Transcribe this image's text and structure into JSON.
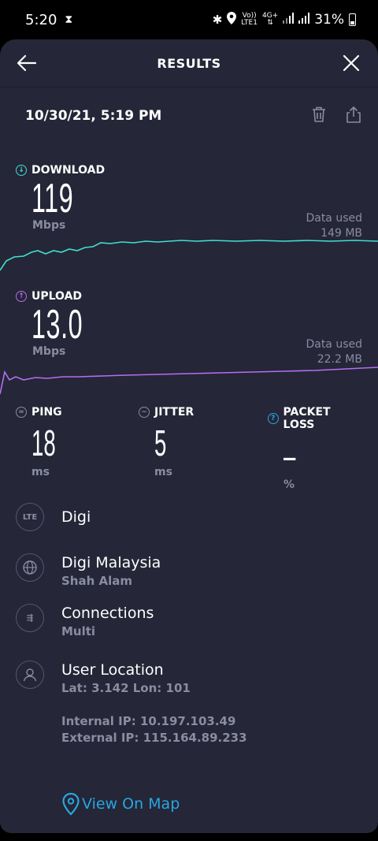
{
  "status_bar": {
    "time": "5:20",
    "carrier_top": "Vo))",
    "carrier_bottom": "LTE1",
    "network_top": "4G+",
    "battery": "31%"
  },
  "header": {
    "title": "RESULTS"
  },
  "result": {
    "datetime": "10/30/21, 5:19 PM"
  },
  "download": {
    "label": "DOWNLOAD",
    "value": "119",
    "unit": "Mbps",
    "data_used_label": "Data used",
    "data_used_value": "149 MB",
    "color": "#3fe0d0"
  },
  "upload": {
    "label": "UPLOAD",
    "value": "13.0",
    "unit": "Mbps",
    "data_used_label": "Data used",
    "data_used_value": "22.2 MB",
    "color": "#b46ef0"
  },
  "ping": {
    "label": "PING",
    "value": "18",
    "unit": "ms"
  },
  "jitter": {
    "label": "JITTER",
    "value": "5",
    "unit": "ms"
  },
  "packet_loss": {
    "label": "PACKET LOSS",
    "value": "–",
    "unit": "%",
    "color": "#29a6e0"
  },
  "provider": {
    "icon_text": "LTE",
    "name": "Digi"
  },
  "server": {
    "name": "Digi Malaysia",
    "location": "Shah Alam"
  },
  "connections": {
    "title": "Connections",
    "value": "Multi"
  },
  "user_location": {
    "title": "User Location",
    "coords": "Lat: 3.142 Lon: 101"
  },
  "ips": {
    "internal": "Internal IP: 10.197.103.49",
    "external": "External IP: 115.164.89.233"
  },
  "map_link": {
    "label": "View On Map",
    "color": "#29a6e0"
  }
}
